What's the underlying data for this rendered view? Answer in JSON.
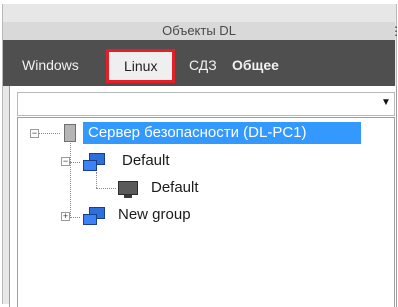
{
  "window": {
    "title": "Объекты DL"
  },
  "tabs": [
    {
      "label": "Windows"
    },
    {
      "label": "Linux"
    },
    {
      "label": "СДЗ"
    },
    {
      "label": "Общее"
    }
  ],
  "selector": {
    "value": ""
  },
  "tree": {
    "root": {
      "label": "Сервер безопасности (DL-PC1)",
      "expanded": true,
      "selected": true
    },
    "groups": [
      {
        "label": "Default",
        "expanded": true,
        "children": [
          {
            "label": "Default"
          }
        ]
      },
      {
        "label": "New group",
        "expanded": false
      }
    ]
  },
  "colors": {
    "selection": "#3399ff",
    "highlight_box": "#e32027",
    "tab_strip": "#4f4f4f"
  }
}
